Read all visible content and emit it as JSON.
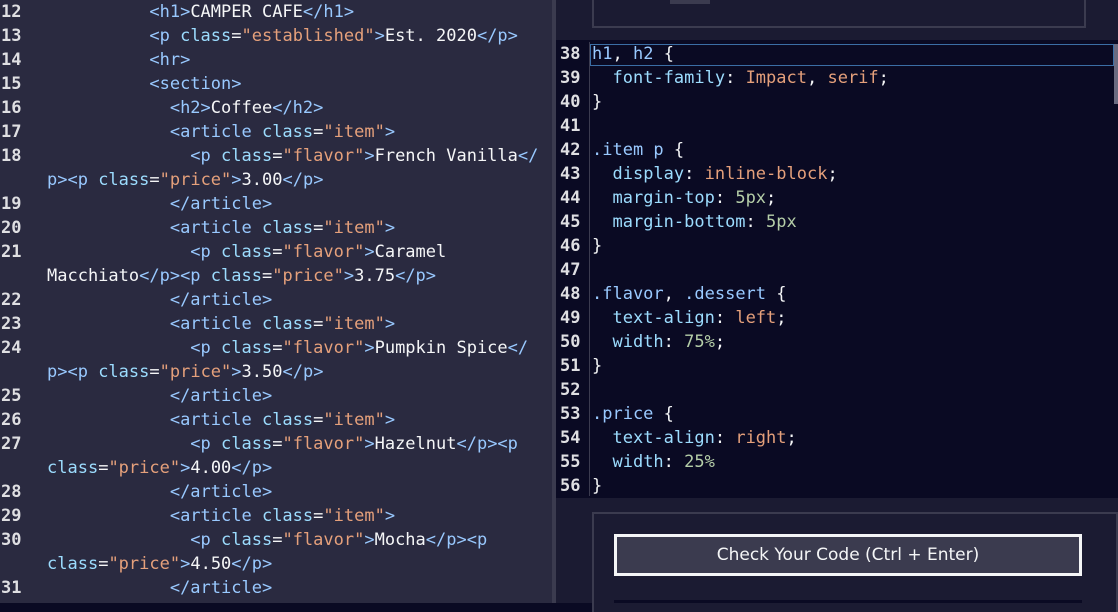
{
  "html_editor": {
    "lines": [
      {
        "num": "12",
        "parts": [
          [
            "t-punct",
            "          "
          ],
          [
            "t-tag",
            "<h1>"
          ],
          [
            "t-text",
            "CAMPER CAFE"
          ],
          [
            "t-tag",
            "</h1>"
          ]
        ]
      },
      {
        "num": "13",
        "parts": [
          [
            "t-punct",
            "          "
          ],
          [
            "t-tag",
            "<p "
          ],
          [
            "t-attr",
            "class"
          ],
          [
            "t-text",
            "="
          ],
          [
            "t-str",
            "\"established\""
          ],
          [
            "t-tag",
            ">"
          ],
          [
            "t-text",
            "Est. 2020"
          ],
          [
            "t-tag",
            "</p>"
          ]
        ]
      },
      {
        "num": "14",
        "parts": [
          [
            "t-punct",
            "          "
          ],
          [
            "t-tag",
            "<hr>"
          ]
        ]
      },
      {
        "num": "15",
        "parts": [
          [
            "t-punct",
            "          "
          ],
          [
            "t-tag",
            "<section>"
          ]
        ]
      },
      {
        "num": "16",
        "parts": [
          [
            "t-punct",
            "            "
          ],
          [
            "t-tag",
            "<h2>"
          ],
          [
            "t-text",
            "Coffee"
          ],
          [
            "t-tag",
            "</h2>"
          ]
        ]
      },
      {
        "num": "17",
        "parts": [
          [
            "t-punct",
            "            "
          ],
          [
            "t-tag",
            "<article "
          ],
          [
            "t-attr",
            "class"
          ],
          [
            "t-text",
            "="
          ],
          [
            "t-str",
            "\"item\""
          ],
          [
            "t-tag",
            ">"
          ]
        ]
      },
      {
        "num": "18",
        "parts": [
          [
            "t-punct",
            "              "
          ],
          [
            "t-tag",
            "<p "
          ],
          [
            "t-attr",
            "class"
          ],
          [
            "t-text",
            "="
          ],
          [
            "t-str",
            "\"flavor\""
          ],
          [
            "t-tag",
            ">"
          ],
          [
            "t-text",
            "French Vanilla"
          ],
          [
            "t-tag",
            "</"
          ]
        ]
      },
      {
        "num": "",
        "parts": [
          [
            "t-tag",
            "p><p "
          ],
          [
            "t-attr",
            "class"
          ],
          [
            "t-text",
            "="
          ],
          [
            "t-str",
            "\"price\""
          ],
          [
            "t-tag",
            ">"
          ],
          [
            "t-text",
            "3.00"
          ],
          [
            "t-tag",
            "</p>"
          ]
        ]
      },
      {
        "num": "19",
        "parts": [
          [
            "t-punct",
            "            "
          ],
          [
            "t-tag",
            "</article>"
          ]
        ]
      },
      {
        "num": "20",
        "parts": [
          [
            "t-punct",
            "            "
          ],
          [
            "t-tag",
            "<article "
          ],
          [
            "t-attr",
            "class"
          ],
          [
            "t-text",
            "="
          ],
          [
            "t-str",
            "\"item\""
          ],
          [
            "t-tag",
            ">"
          ]
        ]
      },
      {
        "num": "21",
        "parts": [
          [
            "t-punct",
            "              "
          ],
          [
            "t-tag",
            "<p "
          ],
          [
            "t-attr",
            "class"
          ],
          [
            "t-text",
            "="
          ],
          [
            "t-str",
            "\"flavor\""
          ],
          [
            "t-tag",
            ">"
          ],
          [
            "t-text",
            "Caramel"
          ]
        ]
      },
      {
        "num": "",
        "parts": [
          [
            "t-text",
            "Macchiato"
          ],
          [
            "t-tag",
            "</p><p "
          ],
          [
            "t-attr",
            "class"
          ],
          [
            "t-text",
            "="
          ],
          [
            "t-str",
            "\"price\""
          ],
          [
            "t-tag",
            ">"
          ],
          [
            "t-text",
            "3.75"
          ],
          [
            "t-tag",
            "</p>"
          ]
        ]
      },
      {
        "num": "22",
        "parts": [
          [
            "t-punct",
            "            "
          ],
          [
            "t-tag",
            "</article>"
          ]
        ]
      },
      {
        "num": "23",
        "parts": [
          [
            "t-punct",
            "            "
          ],
          [
            "t-tag",
            "<article "
          ],
          [
            "t-attr",
            "class"
          ],
          [
            "t-text",
            "="
          ],
          [
            "t-str",
            "\"item\""
          ],
          [
            "t-tag",
            ">"
          ]
        ]
      },
      {
        "num": "24",
        "parts": [
          [
            "t-punct",
            "              "
          ],
          [
            "t-tag",
            "<p "
          ],
          [
            "t-attr",
            "class"
          ],
          [
            "t-text",
            "="
          ],
          [
            "t-str",
            "\"flavor\""
          ],
          [
            "t-tag",
            ">"
          ],
          [
            "t-text",
            "Pumpkin Spice"
          ],
          [
            "t-tag",
            "</"
          ]
        ]
      },
      {
        "num": "",
        "parts": [
          [
            "t-tag",
            "p><p "
          ],
          [
            "t-attr",
            "class"
          ],
          [
            "t-text",
            "="
          ],
          [
            "t-str",
            "\"price\""
          ],
          [
            "t-tag",
            ">"
          ],
          [
            "t-text",
            "3.50"
          ],
          [
            "t-tag",
            "</p>"
          ]
        ]
      },
      {
        "num": "25",
        "parts": [
          [
            "t-punct",
            "            "
          ],
          [
            "t-tag",
            "</article>"
          ]
        ]
      },
      {
        "num": "26",
        "parts": [
          [
            "t-punct",
            "            "
          ],
          [
            "t-tag",
            "<article "
          ],
          [
            "t-attr",
            "class"
          ],
          [
            "t-text",
            "="
          ],
          [
            "t-str",
            "\"item\""
          ],
          [
            "t-tag",
            ">"
          ]
        ]
      },
      {
        "num": "27",
        "parts": [
          [
            "t-punct",
            "              "
          ],
          [
            "t-tag",
            "<p "
          ],
          [
            "t-attr",
            "class"
          ],
          [
            "t-text",
            "="
          ],
          [
            "t-str",
            "\"flavor\""
          ],
          [
            "t-tag",
            ">"
          ],
          [
            "t-text",
            "Hazelnut"
          ],
          [
            "t-tag",
            "</p><p"
          ]
        ]
      },
      {
        "num": "",
        "parts": [
          [
            "t-attr",
            "class"
          ],
          [
            "t-text",
            "="
          ],
          [
            "t-str",
            "\"price\""
          ],
          [
            "t-tag",
            ">"
          ],
          [
            "t-text",
            "4.00"
          ],
          [
            "t-tag",
            "</p>"
          ]
        ]
      },
      {
        "num": "28",
        "parts": [
          [
            "t-punct",
            "            "
          ],
          [
            "t-tag",
            "</article>"
          ]
        ]
      },
      {
        "num": "29",
        "parts": [
          [
            "t-punct",
            "            "
          ],
          [
            "t-tag",
            "<article "
          ],
          [
            "t-attr",
            "class"
          ],
          [
            "t-text",
            "="
          ],
          [
            "t-str",
            "\"item\""
          ],
          [
            "t-tag",
            ">"
          ]
        ]
      },
      {
        "num": "30",
        "parts": [
          [
            "t-punct",
            "              "
          ],
          [
            "t-tag",
            "<p "
          ],
          [
            "t-attr",
            "class"
          ],
          [
            "t-text",
            "="
          ],
          [
            "t-str",
            "\"flavor\""
          ],
          [
            "t-tag",
            ">"
          ],
          [
            "t-text",
            "Mocha"
          ],
          [
            "t-tag",
            "</p><p"
          ]
        ]
      },
      {
        "num": "",
        "parts": [
          [
            "t-attr",
            "class"
          ],
          [
            "t-text",
            "="
          ],
          [
            "t-str",
            "\"price\""
          ],
          [
            "t-tag",
            ">"
          ],
          [
            "t-text",
            "4.50"
          ],
          [
            "t-tag",
            "</p>"
          ]
        ]
      },
      {
        "num": "31",
        "parts": [
          [
            "t-punct",
            "            "
          ],
          [
            "t-tag",
            "</article>"
          ]
        ]
      }
    ]
  },
  "css_editor": {
    "lines": [
      {
        "num": "38",
        "parts": [
          [
            "c-sel",
            "h1"
          ],
          [
            "c-punct",
            ", "
          ],
          [
            "c-sel",
            "h2"
          ],
          [
            "c-punct",
            " {"
          ]
        ]
      },
      {
        "num": "39",
        "parts": [
          [
            "c-punct",
            "  "
          ],
          [
            "c-prop",
            "font-family"
          ],
          [
            "c-punct",
            ": "
          ],
          [
            "c-val",
            "Impact"
          ],
          [
            "c-punct",
            ", "
          ],
          [
            "c-val",
            "serif"
          ],
          [
            "c-punct",
            ";"
          ]
        ]
      },
      {
        "num": "40",
        "parts": [
          [
            "c-punct",
            "}"
          ]
        ]
      },
      {
        "num": "41",
        "parts": []
      },
      {
        "num": "42",
        "parts": [
          [
            "c-sel",
            ".item p"
          ],
          [
            "c-punct",
            " {"
          ]
        ]
      },
      {
        "num": "43",
        "parts": [
          [
            "c-punct",
            "  "
          ],
          [
            "c-prop",
            "display"
          ],
          [
            "c-punct",
            ": "
          ],
          [
            "c-val",
            "inline-block"
          ],
          [
            "c-punct",
            ";"
          ]
        ]
      },
      {
        "num": "44",
        "parts": [
          [
            "c-punct",
            "  "
          ],
          [
            "c-prop",
            "margin-top"
          ],
          [
            "c-punct",
            ": "
          ],
          [
            "c-num",
            "5px"
          ],
          [
            "c-punct",
            ";"
          ]
        ]
      },
      {
        "num": "45",
        "parts": [
          [
            "c-punct",
            "  "
          ],
          [
            "c-prop",
            "margin-bottom"
          ],
          [
            "c-punct",
            ": "
          ],
          [
            "c-num",
            "5px"
          ]
        ]
      },
      {
        "num": "46",
        "parts": [
          [
            "c-punct",
            "}"
          ]
        ]
      },
      {
        "num": "47",
        "parts": []
      },
      {
        "num": "48",
        "parts": [
          [
            "c-sel",
            ".flavor"
          ],
          [
            "c-punct",
            ", "
          ],
          [
            "c-sel",
            ".dessert"
          ],
          [
            "c-punct",
            " {"
          ]
        ]
      },
      {
        "num": "49",
        "parts": [
          [
            "c-punct",
            "  "
          ],
          [
            "c-prop",
            "text-align"
          ],
          [
            "c-punct",
            ": "
          ],
          [
            "c-val",
            "left"
          ],
          [
            "c-punct",
            ";"
          ]
        ]
      },
      {
        "num": "50",
        "parts": [
          [
            "c-punct",
            "  "
          ],
          [
            "c-prop",
            "width"
          ],
          [
            "c-punct",
            ": "
          ],
          [
            "c-num",
            "75%"
          ],
          [
            "c-punct",
            ";"
          ]
        ]
      },
      {
        "num": "51",
        "parts": [
          [
            "c-punct",
            "}"
          ]
        ]
      },
      {
        "num": "52",
        "parts": []
      },
      {
        "num": "53",
        "parts": [
          [
            "c-sel",
            ".price"
          ],
          [
            "c-punct",
            " {"
          ]
        ]
      },
      {
        "num": "54",
        "parts": [
          [
            "c-punct",
            "  "
          ],
          [
            "c-prop",
            "text-align"
          ],
          [
            "c-punct",
            ": "
          ],
          [
            "c-val",
            "right"
          ],
          [
            "c-punct",
            ";"
          ]
        ]
      },
      {
        "num": "55",
        "parts": [
          [
            "c-punct",
            "  "
          ],
          [
            "c-prop",
            "width"
          ],
          [
            "c-punct",
            ": "
          ],
          [
            "c-num",
            "25%"
          ]
        ]
      },
      {
        "num": "56",
        "parts": [
          [
            "c-punct",
            "}"
          ]
        ]
      }
    ]
  },
  "actions": {
    "check_button_label": "Check Your Code (Ctrl + Enter)"
  }
}
